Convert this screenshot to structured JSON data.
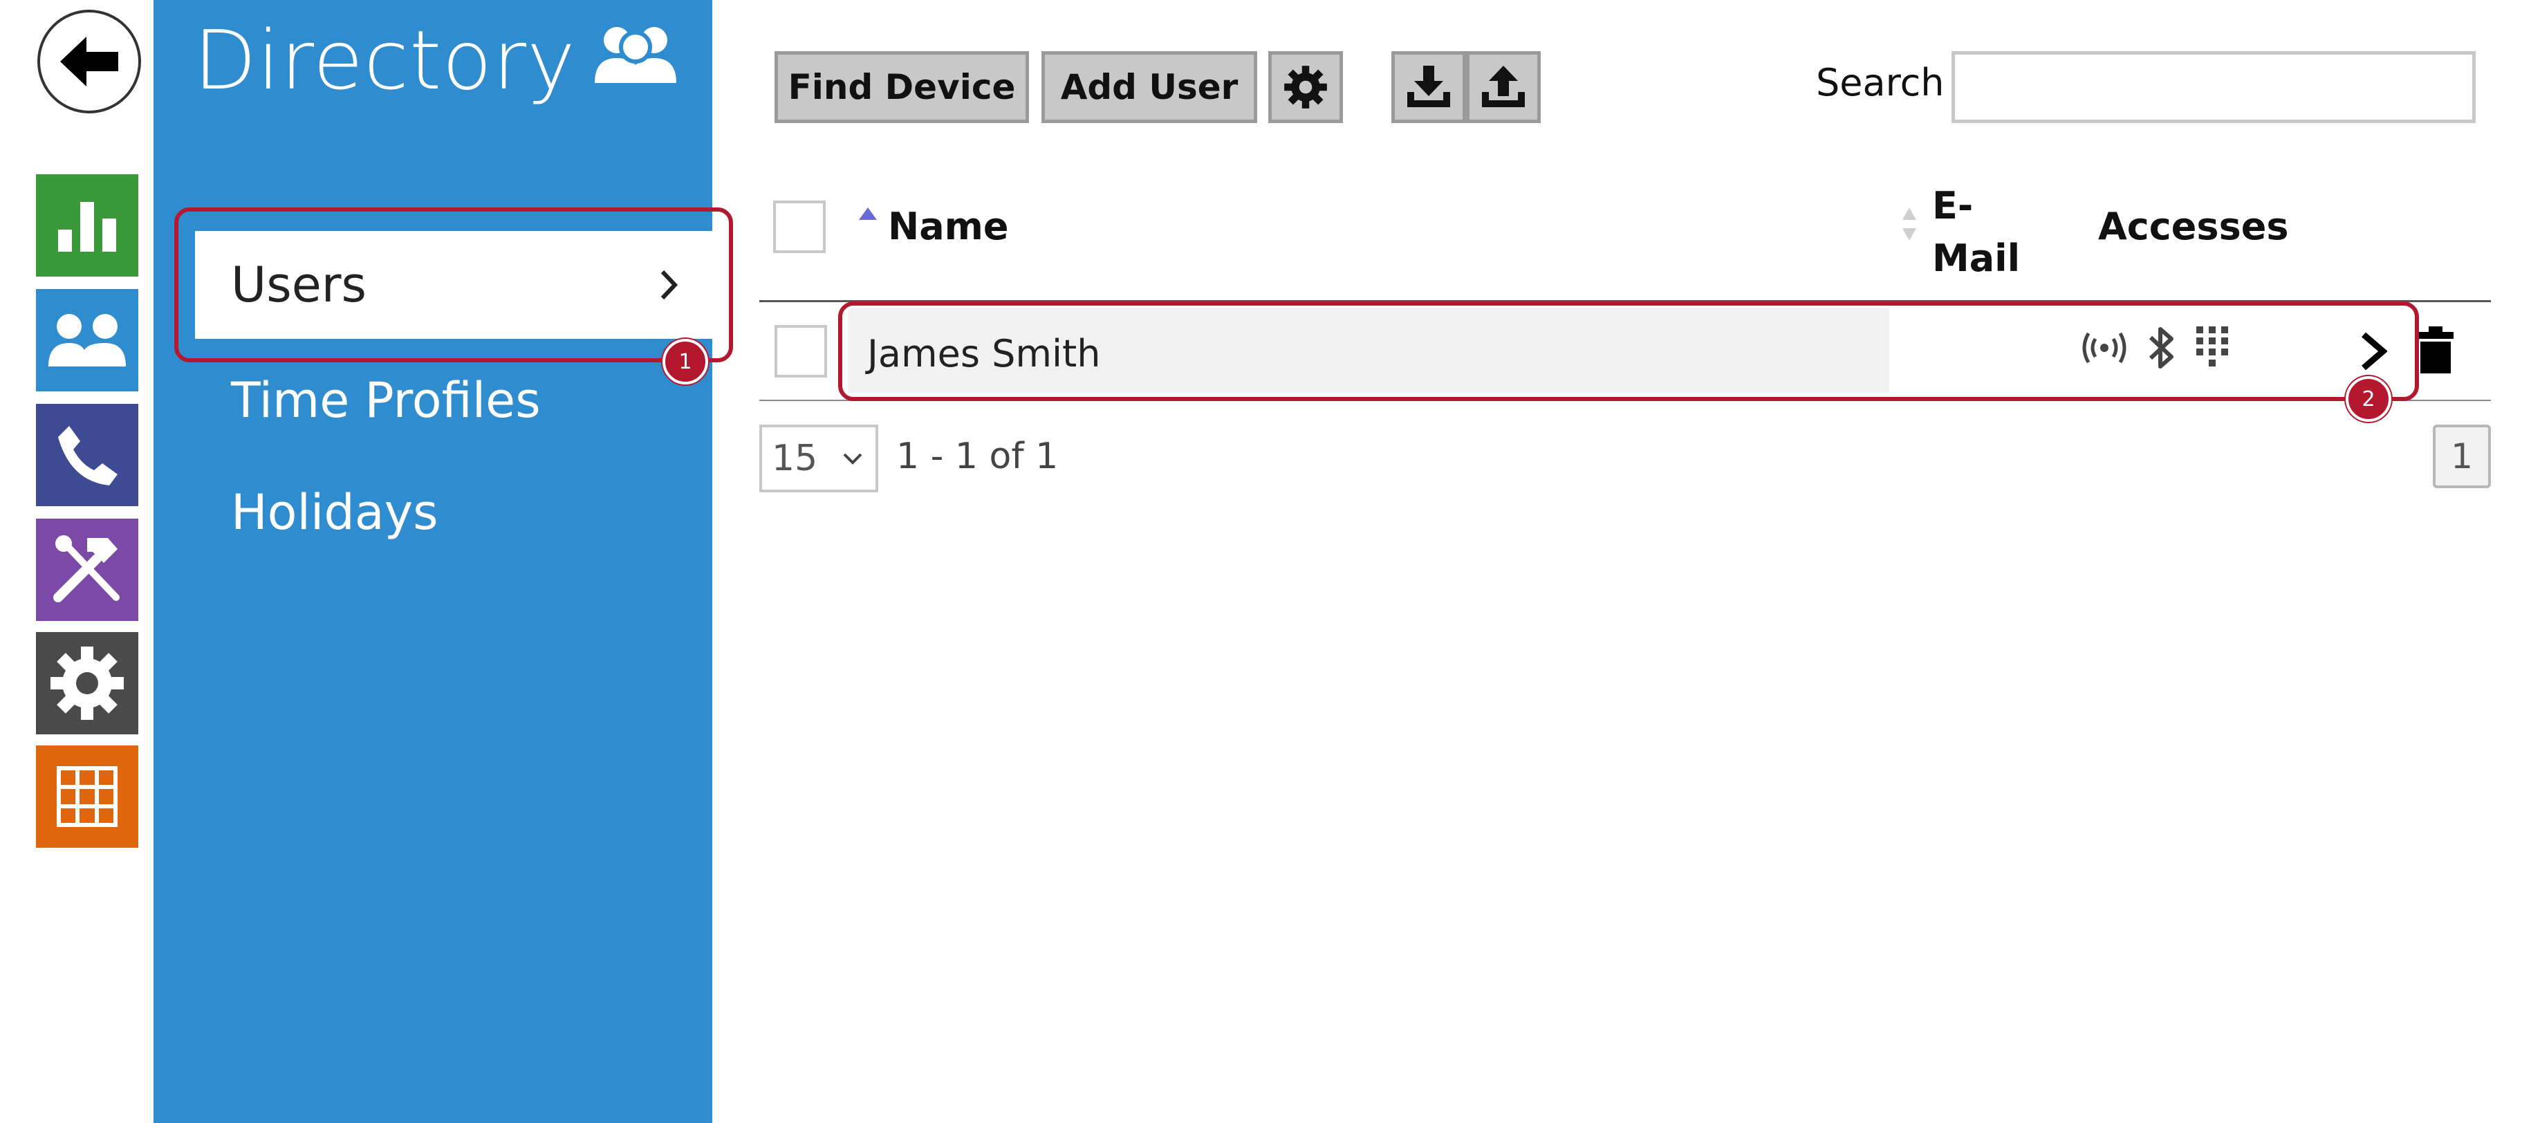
{
  "rail": {
    "items": [
      {
        "icon": "bar-chart-icon",
        "color": "#3a9a3a"
      },
      {
        "icon": "users-icon",
        "color": "#2f8ccf"
      },
      {
        "icon": "phone-icon",
        "color": "#3e4a92"
      },
      {
        "icon": "tools-icon",
        "color": "#7a4aa6"
      },
      {
        "icon": "gear-icon",
        "color": "#4a4a4a"
      },
      {
        "icon": "grid-icon",
        "color": "#e0660e"
      }
    ]
  },
  "panel": {
    "title": "Directory",
    "menu": [
      {
        "label": "Users",
        "active": true
      },
      {
        "label": "Time Profiles",
        "active": false
      },
      {
        "label": "Holidays",
        "active": false
      }
    ]
  },
  "toolbar": {
    "find_device": "Find Device",
    "add_user": "Add User",
    "search_label": "Search",
    "search_value": ""
  },
  "table": {
    "columns": [
      "Name",
      "E-Mail",
      "Accesses"
    ],
    "email_line1": "E-",
    "email_line2": "Mail",
    "rows": [
      {
        "name": "James Smith",
        "email": "",
        "accesses": [
          "rfid-icon",
          "bluetooth-icon",
          "keypad-icon"
        ]
      }
    ]
  },
  "pager": {
    "page_size": "15",
    "range_text": "1 - 1 of 1",
    "current_page": "1"
  },
  "callouts": [
    "1",
    "2"
  ],
  "colors": {
    "accent": "#2f8ccf",
    "callout": "#b3182e"
  }
}
